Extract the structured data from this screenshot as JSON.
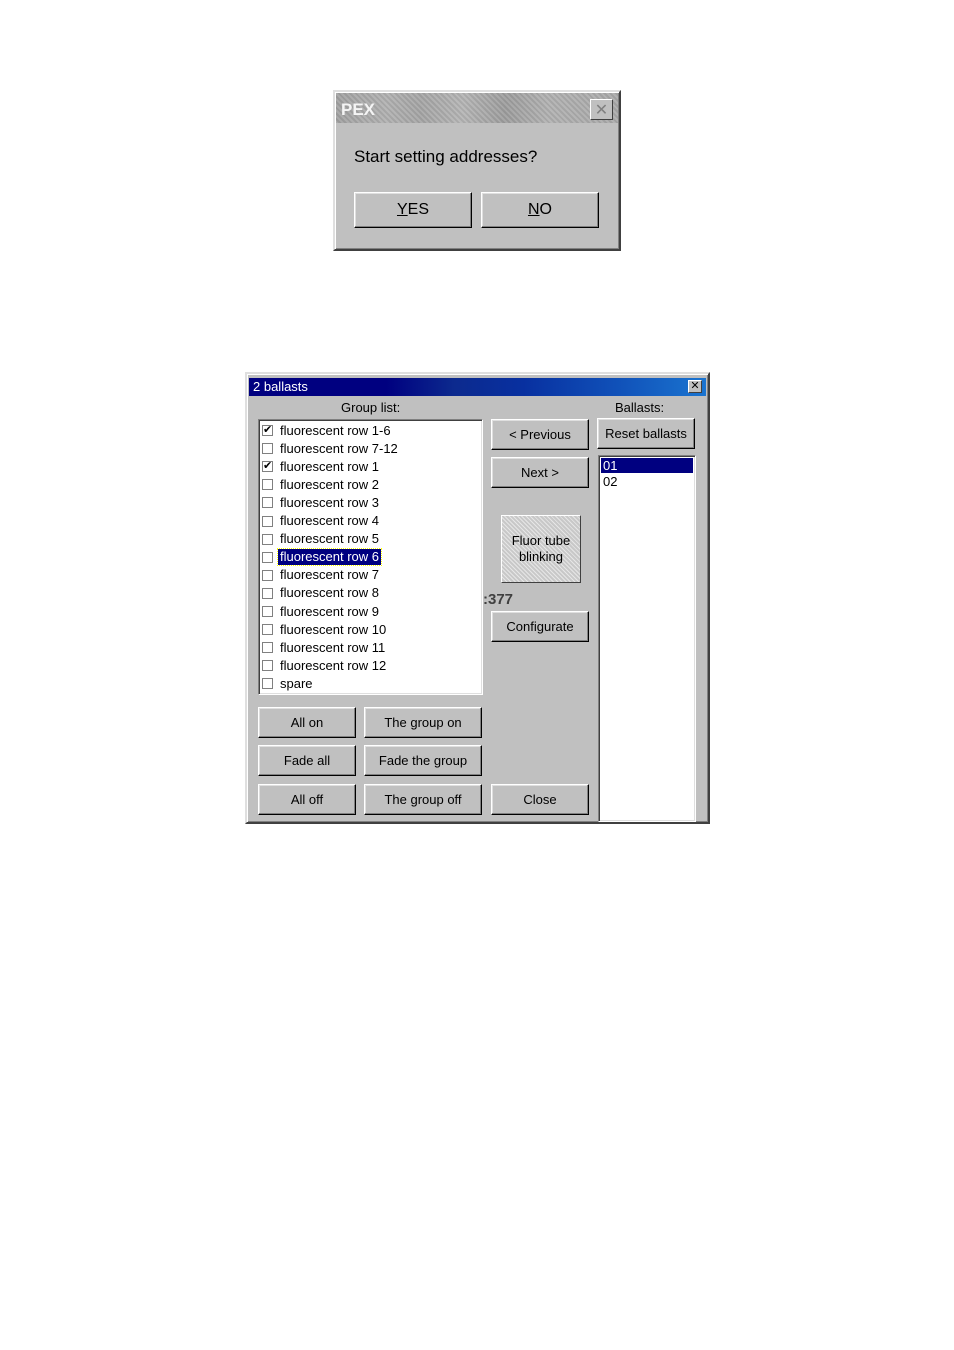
{
  "pex_dialog": {
    "title": "PEX",
    "close_glyph": "✕",
    "message": "Start setting addresses?",
    "yes": {
      "underline": "Y",
      "rest": "ES"
    },
    "no": {
      "underline": "N",
      "rest": "O"
    }
  },
  "ballast_dialog": {
    "title": "2 ballasts",
    "close_glyph": "✕",
    "group_list_label": "Group list:",
    "ballasts_label": "Ballasts:",
    "groups": [
      {
        "label": "fluorescent row 1-6",
        "checked": true,
        "selected": false
      },
      {
        "label": "fluorescent row 7-12",
        "checked": false,
        "selected": false
      },
      {
        "label": "fluorescent row 1",
        "checked": true,
        "selected": false
      },
      {
        "label": "fluorescent row 2",
        "checked": false,
        "selected": false
      },
      {
        "label": "fluorescent row 3",
        "checked": false,
        "selected": false
      },
      {
        "label": "fluorescent row 4",
        "checked": false,
        "selected": false
      },
      {
        "label": "fluorescent row 5",
        "checked": false,
        "selected": false
      },
      {
        "label": "fluorescent row 6",
        "checked": false,
        "selected": true
      },
      {
        "label": "fluorescent row 7",
        "checked": false,
        "selected": false
      },
      {
        "label": "fluorescent row 8",
        "checked": false,
        "selected": false
      },
      {
        "label": "fluorescent row 9",
        "checked": false,
        "selected": false
      },
      {
        "label": "fluorescent row 10",
        "checked": false,
        "selected": false
      },
      {
        "label": "fluorescent row 11",
        "checked": false,
        "selected": false
      },
      {
        "label": "fluorescent row 12",
        "checked": false,
        "selected": false
      },
      {
        "label": "spare",
        "checked": false,
        "selected": false
      }
    ],
    "ballasts": [
      {
        "label": "01",
        "selected": true
      },
      {
        "label": "02",
        "selected": false
      }
    ],
    "buttons": {
      "previous": "< Previous",
      "next": "Next >",
      "reset_ballasts": "Reset ballasts",
      "configurate": "Configurate",
      "all_on": "All on",
      "group_on": "The group on",
      "fade_all": "Fade all",
      "fade_group": "Fade the group",
      "all_off": "All off",
      "group_off": "The group off",
      "close": "Close"
    },
    "status_line1": "Fluor tube",
    "status_line2": "blinking",
    "counter": ":377"
  }
}
